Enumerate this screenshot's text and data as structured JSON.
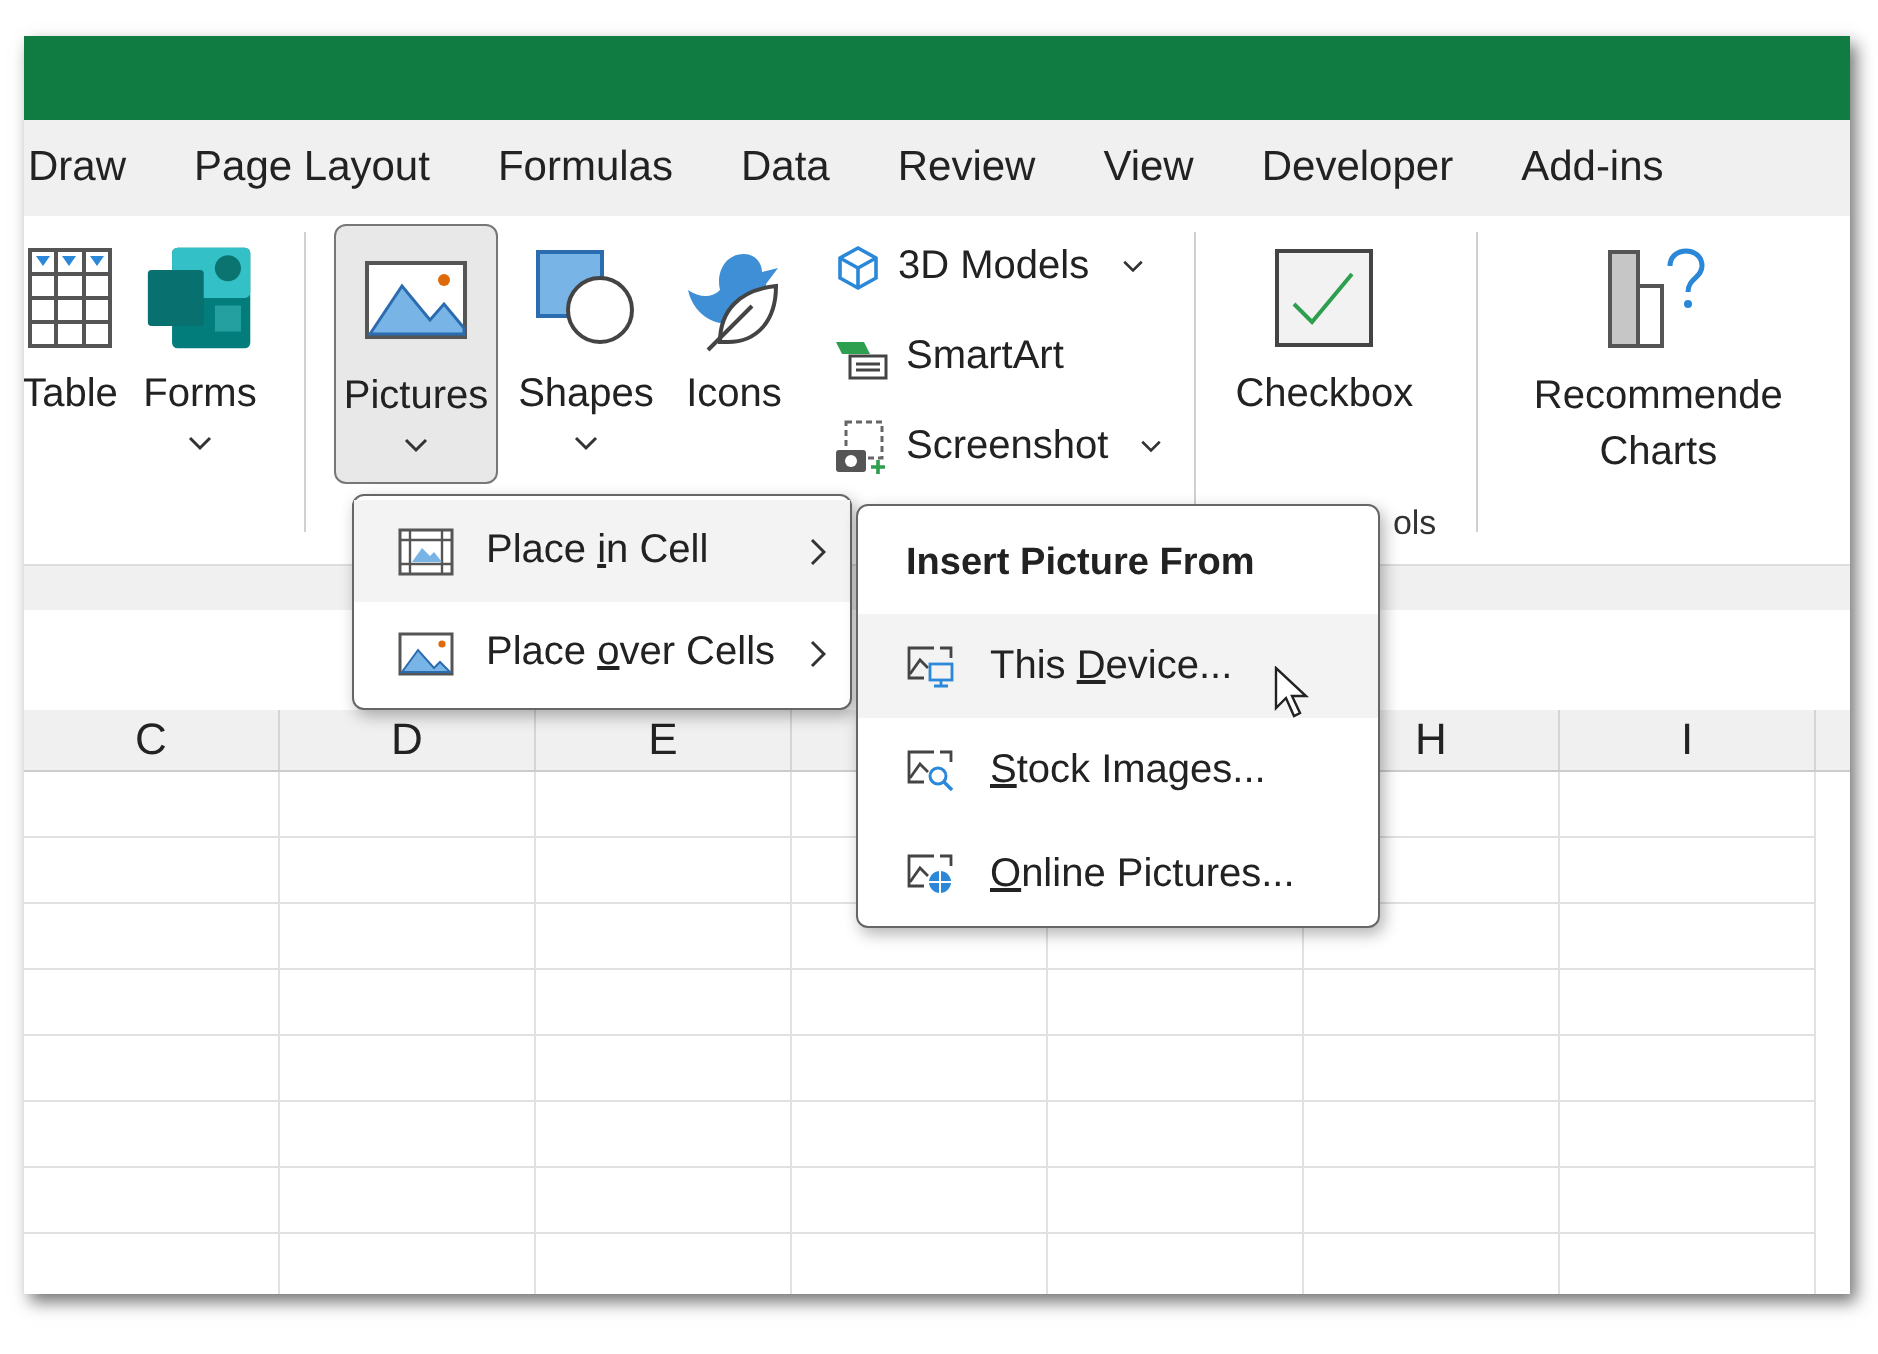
{
  "tabs": [
    {
      "label": "Draw",
      "selected": false
    },
    {
      "label": "Page Layout",
      "selected": false
    },
    {
      "label": "Formulas",
      "selected": false
    },
    {
      "label": "Data",
      "selected": false
    },
    {
      "label": "Review",
      "selected": false
    },
    {
      "label": "View",
      "selected": false
    },
    {
      "label": "Developer",
      "selected": false
    },
    {
      "label": "Add-ins",
      "selected": false
    }
  ],
  "ribbon": {
    "table": {
      "label": "Table"
    },
    "forms": {
      "label": "Forms",
      "dropdown": true
    },
    "pictures": {
      "label": "Pictures",
      "dropdown": true,
      "pressed": true
    },
    "shapes": {
      "label": "Shapes",
      "dropdown": true
    },
    "icons": {
      "label": "Icons",
      "dropdown": false
    },
    "small_buttons": [
      {
        "label": "3D Models",
        "dropdown": true
      },
      {
        "label": "SmartArt",
        "dropdown": false
      },
      {
        "label": "Screenshot",
        "dropdown": true
      }
    ],
    "checkbox": {
      "label": "Checkbox"
    },
    "group_label": "ols",
    "recommended_charts": {
      "label_lines": [
        "Recommende",
        "Charts"
      ]
    }
  },
  "columns": [
    "C",
    "D",
    "E",
    "H",
    "I"
  ],
  "pictures_menu": [
    {
      "before": "Place ",
      "key": "i",
      "after": "n Cell",
      "highlighted": true
    },
    {
      "before": "Place ",
      "key": "o",
      "after": "ver Cells",
      "highlighted": false
    }
  ],
  "submenu": {
    "title": "Insert Picture From",
    "items": [
      {
        "before": "This ",
        "key": "D",
        "after": "evice...",
        "highlighted": true
      },
      {
        "key": "S",
        "after": "tock Images...",
        "highlighted": false
      },
      {
        "key": "O",
        "after": "nline Pictures...",
        "highlighted": false
      }
    ]
  }
}
